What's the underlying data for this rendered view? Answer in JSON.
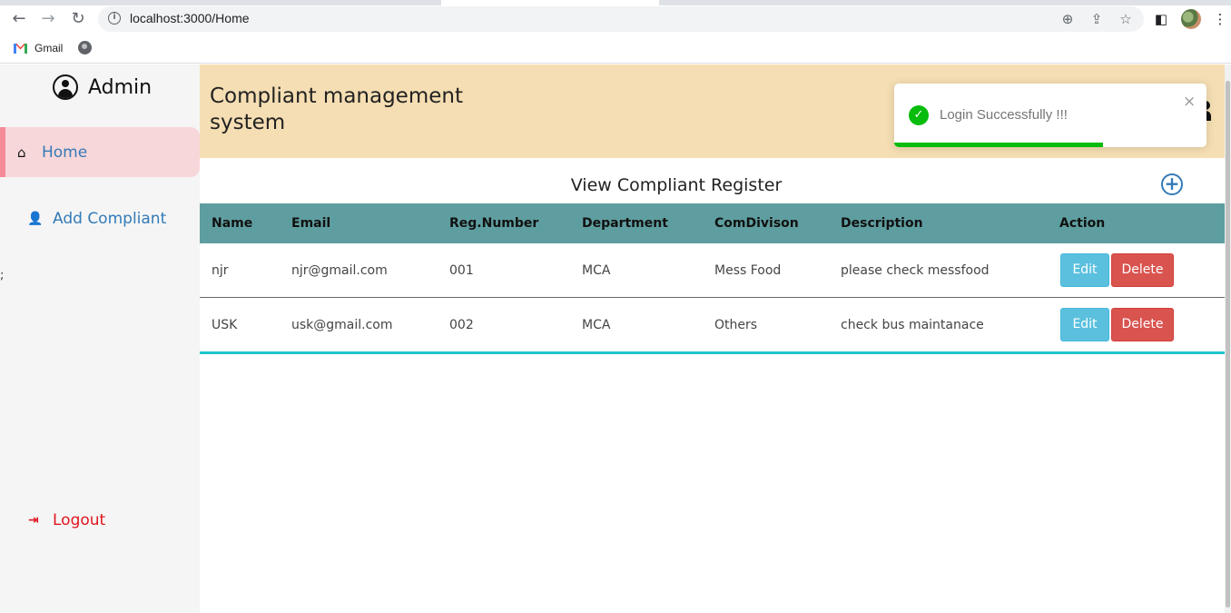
{
  "browser": {
    "url": "localhost:3000/Home",
    "bookmark_gmail": "Gmail"
  },
  "sidebar": {
    "admin_label": "Admin",
    "home_label": "Home",
    "add_label": "Add Compliant",
    "stray_text": ";",
    "logout_label": "Logout"
  },
  "header": {
    "title": "Compliant management system"
  },
  "toast": {
    "message": "Login Successfully !!!",
    "close": "×",
    "progress": 0.67
  },
  "main": {
    "view_title": "View Compliant Register",
    "columns": [
      "Name",
      "Email",
      "Reg.Number",
      "Department",
      "ComDivison",
      "Description",
      "Action"
    ],
    "rows": [
      {
        "name": "njr",
        "email": "njr@gmail.com",
        "reg": "001",
        "dept": "MCA",
        "division": "Mess Food",
        "description": "please check messfood"
      },
      {
        "name": "USK",
        "email": "usk@gmail.com",
        "reg": "002",
        "dept": "MCA",
        "division": "Others",
        "description": "check bus maintanace"
      }
    ],
    "edit_label": "Edit",
    "delete_label": "Delete"
  },
  "colors": {
    "header_bg": "#f5deb3",
    "table_head_bg": "#5f9ea0",
    "home_active_bg": "#f8d7da",
    "link": "#337ab7",
    "logout": "#e0151e",
    "toast_success": "#07bc0c"
  }
}
